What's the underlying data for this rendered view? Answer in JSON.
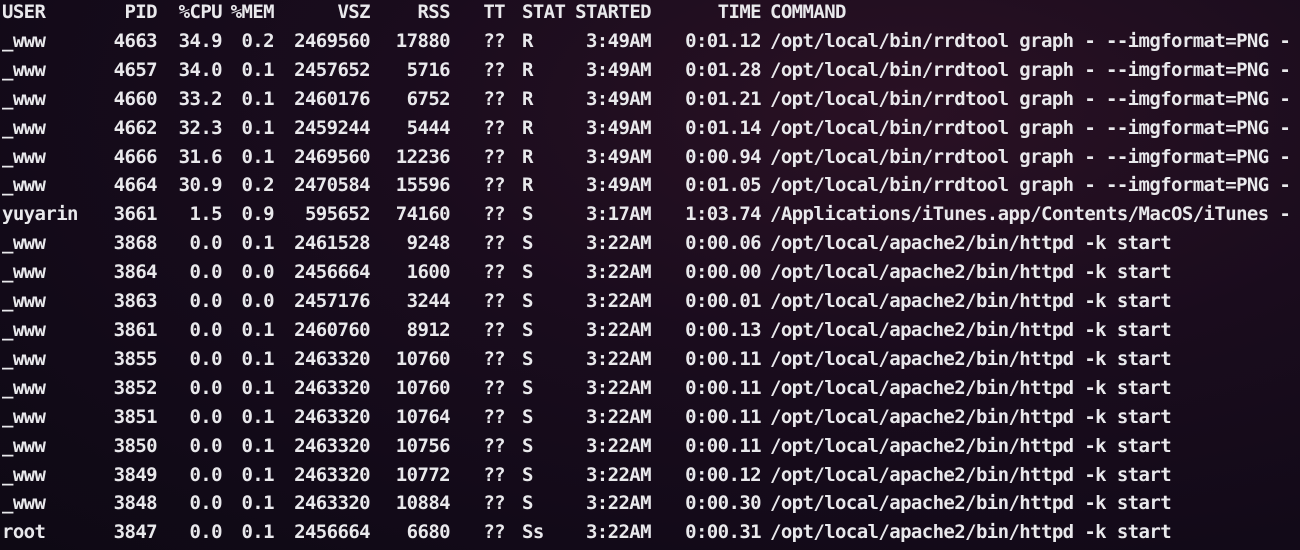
{
  "terminal": {
    "colors": {
      "background": "#140b18",
      "text": "#e9e9ec"
    },
    "header": {
      "user": "USER",
      "pid": "PID",
      "cpu": "%CPU",
      "mem": "%MEM",
      "vsz": "VSZ",
      "rss": "RSS",
      "tt": "TT",
      "stat": "STAT",
      "started": "STARTED",
      "time": "TIME",
      "command": "COMMAND"
    },
    "rows": [
      {
        "user": "_www",
        "pid": "4663",
        "cpu": "34.9",
        "mem": "0.2",
        "vsz": "2469560",
        "rss": "17880",
        "tt": "??",
        "stat": "R",
        "started": "3:49AM",
        "time": "0:01.12",
        "command": "/opt/local/bin/rrdtool graph - --imgformat=PNG -"
      },
      {
        "user": "_www",
        "pid": "4657",
        "cpu": "34.0",
        "mem": "0.1",
        "vsz": "2457652",
        "rss": "5716",
        "tt": "??",
        "stat": "R",
        "started": "3:49AM",
        "time": "0:01.28",
        "command": "/opt/local/bin/rrdtool graph - --imgformat=PNG -"
      },
      {
        "user": "_www",
        "pid": "4660",
        "cpu": "33.2",
        "mem": "0.1",
        "vsz": "2460176",
        "rss": "6752",
        "tt": "??",
        "stat": "R",
        "started": "3:49AM",
        "time": "0:01.21",
        "command": "/opt/local/bin/rrdtool graph - --imgformat=PNG -"
      },
      {
        "user": "_www",
        "pid": "4662",
        "cpu": "32.3",
        "mem": "0.1",
        "vsz": "2459244",
        "rss": "5444",
        "tt": "??",
        "stat": "R",
        "started": "3:49AM",
        "time": "0:01.14",
        "command": "/opt/local/bin/rrdtool graph - --imgformat=PNG -"
      },
      {
        "user": "_www",
        "pid": "4666",
        "cpu": "31.6",
        "mem": "0.1",
        "vsz": "2469560",
        "rss": "12236",
        "tt": "??",
        "stat": "R",
        "started": "3:49AM",
        "time": "0:00.94",
        "command": "/opt/local/bin/rrdtool graph - --imgformat=PNG -"
      },
      {
        "user": "_www",
        "pid": "4664",
        "cpu": "30.9",
        "mem": "0.2",
        "vsz": "2470584",
        "rss": "15596",
        "tt": "??",
        "stat": "R",
        "started": "3:49AM",
        "time": "0:01.05",
        "command": "/opt/local/bin/rrdtool graph - --imgformat=PNG -"
      },
      {
        "user": "yuyarin",
        "pid": "3661",
        "cpu": "1.5",
        "mem": "0.9",
        "vsz": "595652",
        "rss": "74160",
        "tt": "??",
        "stat": "S",
        "started": "3:17AM",
        "time": "1:03.74",
        "command": "/Applications/iTunes.app/Contents/MacOS/iTunes -"
      },
      {
        "user": "_www",
        "pid": "3868",
        "cpu": "0.0",
        "mem": "0.1",
        "vsz": "2461528",
        "rss": "9248",
        "tt": "??",
        "stat": "S",
        "started": "3:22AM",
        "time": "0:00.06",
        "command": "/opt/local/apache2/bin/httpd -k start"
      },
      {
        "user": "_www",
        "pid": "3864",
        "cpu": "0.0",
        "mem": "0.0",
        "vsz": "2456664",
        "rss": "1600",
        "tt": "??",
        "stat": "S",
        "started": "3:22AM",
        "time": "0:00.00",
        "command": "/opt/local/apache2/bin/httpd -k start"
      },
      {
        "user": "_www",
        "pid": "3863",
        "cpu": "0.0",
        "mem": "0.0",
        "vsz": "2457176",
        "rss": "3244",
        "tt": "??",
        "stat": "S",
        "started": "3:22AM",
        "time": "0:00.01",
        "command": "/opt/local/apache2/bin/httpd -k start"
      },
      {
        "user": "_www",
        "pid": "3861",
        "cpu": "0.0",
        "mem": "0.1",
        "vsz": "2460760",
        "rss": "8912",
        "tt": "??",
        "stat": "S",
        "started": "3:22AM",
        "time": "0:00.13",
        "command": "/opt/local/apache2/bin/httpd -k start"
      },
      {
        "user": "_www",
        "pid": "3855",
        "cpu": "0.0",
        "mem": "0.1",
        "vsz": "2463320",
        "rss": "10760",
        "tt": "??",
        "stat": "S",
        "started": "3:22AM",
        "time": "0:00.11",
        "command": "/opt/local/apache2/bin/httpd -k start"
      },
      {
        "user": "_www",
        "pid": "3852",
        "cpu": "0.0",
        "mem": "0.1",
        "vsz": "2463320",
        "rss": "10760",
        "tt": "??",
        "stat": "S",
        "started": "3:22AM",
        "time": "0:00.11",
        "command": "/opt/local/apache2/bin/httpd -k start"
      },
      {
        "user": "_www",
        "pid": "3851",
        "cpu": "0.0",
        "mem": "0.1",
        "vsz": "2463320",
        "rss": "10764",
        "tt": "??",
        "stat": "S",
        "started": "3:22AM",
        "time": "0:00.11",
        "command": "/opt/local/apache2/bin/httpd -k start"
      },
      {
        "user": "_www",
        "pid": "3850",
        "cpu": "0.0",
        "mem": "0.1",
        "vsz": "2463320",
        "rss": "10756",
        "tt": "??",
        "stat": "S",
        "started": "3:22AM",
        "time": "0:00.11",
        "command": "/opt/local/apache2/bin/httpd -k start"
      },
      {
        "user": "_www",
        "pid": "3849",
        "cpu": "0.0",
        "mem": "0.1",
        "vsz": "2463320",
        "rss": "10772",
        "tt": "??",
        "stat": "S",
        "started": "3:22AM",
        "time": "0:00.12",
        "command": "/opt/local/apache2/bin/httpd -k start"
      },
      {
        "user": "_www",
        "pid": "3848",
        "cpu": "0.0",
        "mem": "0.1",
        "vsz": "2463320",
        "rss": "10884",
        "tt": "??",
        "stat": "S",
        "started": "3:22AM",
        "time": "0:00.30",
        "command": "/opt/local/apache2/bin/httpd -k start"
      },
      {
        "user": "root",
        "pid": "3847",
        "cpu": "0.0",
        "mem": "0.1",
        "vsz": "2456664",
        "rss": "6680",
        "tt": "??",
        "stat": "Ss",
        "started": "3:22AM",
        "time": "0:00.31",
        "command": "/opt/local/apache2/bin/httpd -k start"
      }
    ]
  }
}
